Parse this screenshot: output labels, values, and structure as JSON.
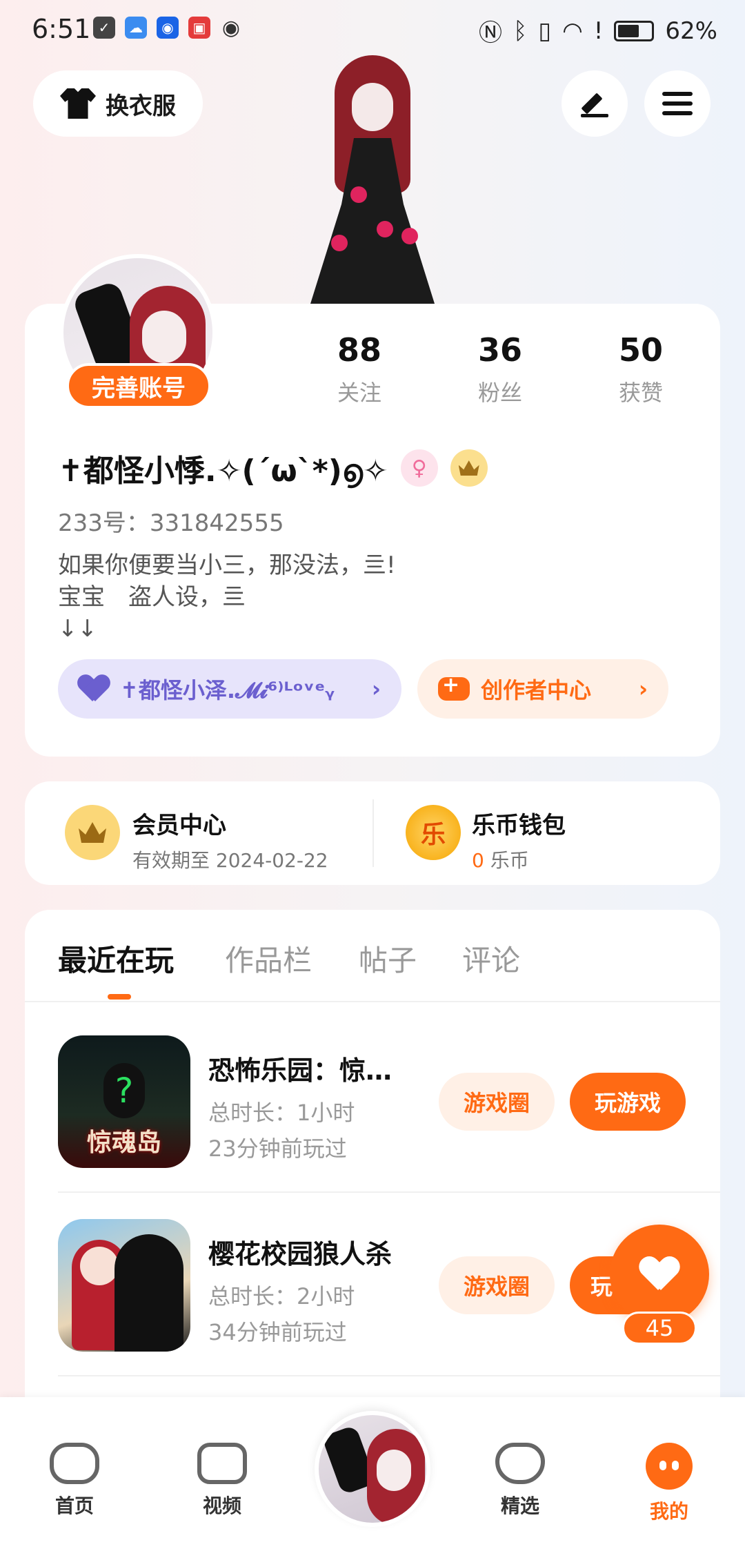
{
  "status_bar": {
    "time": "6:51",
    "battery": "62%"
  },
  "header": {
    "outfit_label": "换衣服"
  },
  "profile": {
    "complete_account": "完善账号",
    "stats": [
      {
        "num": "88",
        "label": "关注"
      },
      {
        "num": "36",
        "label": "粉丝"
      },
      {
        "num": "50",
        "label": "获赞"
      }
    ],
    "nickname": "✝都怪小悸.✧(´ω`*)൭✧",
    "user_id": "233号：331842555",
    "bio": "如果你便要当小三，那没法，亖!\n宝宝　盗人设，亖\n↓↓",
    "partner_label": "✝都怪小泽.𝓜𝓲⁶⁾ᴸᵒᵛᵉᵧ",
    "creator_label": "创作者中心"
  },
  "member": {
    "vip_title": "会员中心",
    "vip_sub": "有效期至 2024-02-22",
    "wallet_title": "乐币钱包",
    "wallet_coin_char": "乐",
    "wallet_amount": "0",
    "wallet_unit": "乐币"
  },
  "tabs": [
    "最近在玩",
    "作品栏",
    "帖子",
    "评论"
  ],
  "games": [
    {
      "title": "恐怖乐园：惊…",
      "duration": "总时长：1小时",
      "last_played": "23分钟前玩过",
      "icon_text": "惊魂岛",
      "circle_label": "游戏圈",
      "play_label": "玩游戏"
    },
    {
      "title": "樱花校园狼人杀",
      "duration": "总时长：2小时",
      "last_played": "34分钟前玩过",
      "circle_label": "游戏圈",
      "play_label": "玩"
    }
  ],
  "float_like": {
    "count": "45"
  },
  "bottom_nav": {
    "home": "首页",
    "video": "视频",
    "featured": "精选",
    "mine": "我的"
  }
}
